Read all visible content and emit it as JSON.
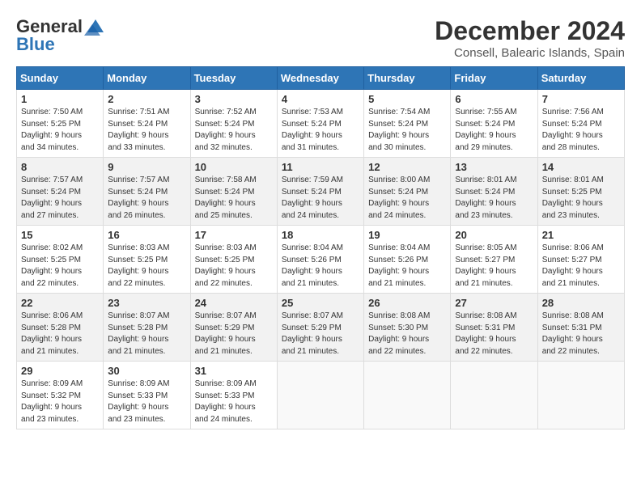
{
  "logo": {
    "general": "General",
    "blue": "Blue"
  },
  "title": {
    "month_year": "December 2024",
    "location": "Consell, Balearic Islands, Spain"
  },
  "headers": [
    "Sunday",
    "Monday",
    "Tuesday",
    "Wednesday",
    "Thursday",
    "Friday",
    "Saturday"
  ],
  "weeks": [
    [
      {
        "day": "1",
        "info": "Sunrise: 7:50 AM\nSunset: 5:25 PM\nDaylight: 9 hours\nand 34 minutes."
      },
      {
        "day": "2",
        "info": "Sunrise: 7:51 AM\nSunset: 5:24 PM\nDaylight: 9 hours\nand 33 minutes."
      },
      {
        "day": "3",
        "info": "Sunrise: 7:52 AM\nSunset: 5:24 PM\nDaylight: 9 hours\nand 32 minutes."
      },
      {
        "day": "4",
        "info": "Sunrise: 7:53 AM\nSunset: 5:24 PM\nDaylight: 9 hours\nand 31 minutes."
      },
      {
        "day": "5",
        "info": "Sunrise: 7:54 AM\nSunset: 5:24 PM\nDaylight: 9 hours\nand 30 minutes."
      },
      {
        "day": "6",
        "info": "Sunrise: 7:55 AM\nSunset: 5:24 PM\nDaylight: 9 hours\nand 29 minutes."
      },
      {
        "day": "7",
        "info": "Sunrise: 7:56 AM\nSunset: 5:24 PM\nDaylight: 9 hours\nand 28 minutes."
      }
    ],
    [
      {
        "day": "8",
        "info": "Sunrise: 7:57 AM\nSunset: 5:24 PM\nDaylight: 9 hours\nand 27 minutes."
      },
      {
        "day": "9",
        "info": "Sunrise: 7:57 AM\nSunset: 5:24 PM\nDaylight: 9 hours\nand 26 minutes."
      },
      {
        "day": "10",
        "info": "Sunrise: 7:58 AM\nSunset: 5:24 PM\nDaylight: 9 hours\nand 25 minutes."
      },
      {
        "day": "11",
        "info": "Sunrise: 7:59 AM\nSunset: 5:24 PM\nDaylight: 9 hours\nand 24 minutes."
      },
      {
        "day": "12",
        "info": "Sunrise: 8:00 AM\nSunset: 5:24 PM\nDaylight: 9 hours\nand 24 minutes."
      },
      {
        "day": "13",
        "info": "Sunrise: 8:01 AM\nSunset: 5:24 PM\nDaylight: 9 hours\nand 23 minutes."
      },
      {
        "day": "14",
        "info": "Sunrise: 8:01 AM\nSunset: 5:25 PM\nDaylight: 9 hours\nand 23 minutes."
      }
    ],
    [
      {
        "day": "15",
        "info": "Sunrise: 8:02 AM\nSunset: 5:25 PM\nDaylight: 9 hours\nand 22 minutes."
      },
      {
        "day": "16",
        "info": "Sunrise: 8:03 AM\nSunset: 5:25 PM\nDaylight: 9 hours\nand 22 minutes."
      },
      {
        "day": "17",
        "info": "Sunrise: 8:03 AM\nSunset: 5:25 PM\nDaylight: 9 hours\nand 22 minutes."
      },
      {
        "day": "18",
        "info": "Sunrise: 8:04 AM\nSunset: 5:26 PM\nDaylight: 9 hours\nand 21 minutes."
      },
      {
        "day": "19",
        "info": "Sunrise: 8:04 AM\nSunset: 5:26 PM\nDaylight: 9 hours\nand 21 minutes."
      },
      {
        "day": "20",
        "info": "Sunrise: 8:05 AM\nSunset: 5:27 PM\nDaylight: 9 hours\nand 21 minutes."
      },
      {
        "day": "21",
        "info": "Sunrise: 8:06 AM\nSunset: 5:27 PM\nDaylight: 9 hours\nand 21 minutes."
      }
    ],
    [
      {
        "day": "22",
        "info": "Sunrise: 8:06 AM\nSunset: 5:28 PM\nDaylight: 9 hours\nand 21 minutes."
      },
      {
        "day": "23",
        "info": "Sunrise: 8:07 AM\nSunset: 5:28 PM\nDaylight: 9 hours\nand 21 minutes."
      },
      {
        "day": "24",
        "info": "Sunrise: 8:07 AM\nSunset: 5:29 PM\nDaylight: 9 hours\nand 21 minutes."
      },
      {
        "day": "25",
        "info": "Sunrise: 8:07 AM\nSunset: 5:29 PM\nDaylight: 9 hours\nand 21 minutes."
      },
      {
        "day": "26",
        "info": "Sunrise: 8:08 AM\nSunset: 5:30 PM\nDaylight: 9 hours\nand 22 minutes."
      },
      {
        "day": "27",
        "info": "Sunrise: 8:08 AM\nSunset: 5:31 PM\nDaylight: 9 hours\nand 22 minutes."
      },
      {
        "day": "28",
        "info": "Sunrise: 8:08 AM\nSunset: 5:31 PM\nDaylight: 9 hours\nand 22 minutes."
      }
    ],
    [
      {
        "day": "29",
        "info": "Sunrise: 8:09 AM\nSunset: 5:32 PM\nDaylight: 9 hours\nand 23 minutes."
      },
      {
        "day": "30",
        "info": "Sunrise: 8:09 AM\nSunset: 5:33 PM\nDaylight: 9 hours\nand 23 minutes."
      },
      {
        "day": "31",
        "info": "Sunrise: 8:09 AM\nSunset: 5:33 PM\nDaylight: 9 hours\nand 24 minutes."
      },
      null,
      null,
      null,
      null
    ]
  ]
}
